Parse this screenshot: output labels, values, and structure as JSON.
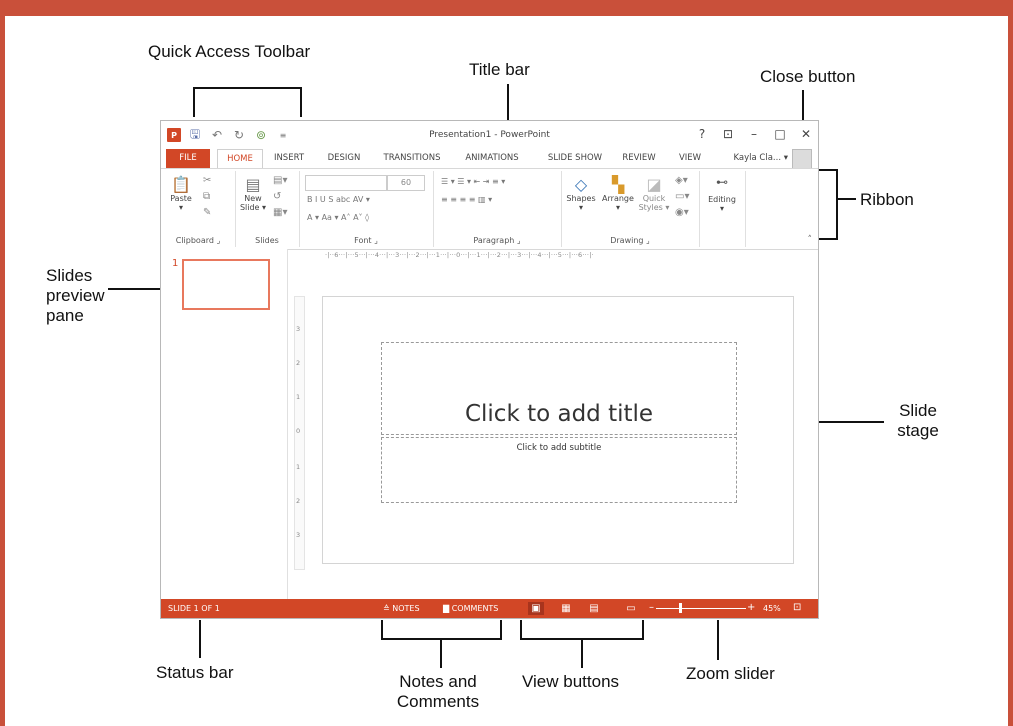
{
  "callouts": {
    "quick_access_toolbar": "Quick Access Toolbar",
    "title_bar": "Title bar",
    "close_button": "Close button",
    "ribbon": "Ribbon",
    "slides_preview_pane_l1": "Slides",
    "slides_preview_pane_l2": "preview",
    "slides_preview_pane_l3": "pane",
    "slide_stage_l1": "Slide",
    "slide_stage_l2": "stage",
    "status_bar": "Status bar",
    "notes_comments_l1": "Notes and",
    "notes_comments_l2": "Comments",
    "view_buttons": "View buttons",
    "zoom_slider": "Zoom slider"
  },
  "window": {
    "title": "Presentation1 - PowerPoint",
    "app_icon": "P",
    "help": "?",
    "ribbon_display": "⊡",
    "minimize": "–",
    "maximize": "□",
    "close": "✕"
  },
  "tabs": [
    "FILE",
    "HOME",
    "INSERT",
    "DESIGN",
    "TRANSITIONS",
    "ANIMATIONS",
    "SLIDE SHOW",
    "REVIEW",
    "VIEW"
  ],
  "user": "Kayla Cla... ▾",
  "ribbon": {
    "paste": "Paste",
    "new_slide_l1": "New",
    "new_slide_l2": "Slide ▾",
    "font_size": "60",
    "shapes": "Shapes",
    "arrange": "Arrange",
    "quick_styles_l1": "Quick",
    "quick_styles_l2": "Styles ▾",
    "editing": "Editing",
    "groups": {
      "clipboard": "Clipboard",
      "slides": "Slides",
      "font": "Font",
      "paragraph": "Paragraph",
      "drawing": "Drawing"
    },
    "font_format": "B  I  U  S  abc  AV ▾",
    "font_size_row": "A ▾  Aa ▾   A˄  A˅   ◊",
    "para_row1": "☰ ▾  ☰ ▾   ⇤  ⇥   ≡ ▾",
    "para_row2": "≡  ≡  ≡  ≡   ▥ ▾"
  },
  "pane": {
    "slide_number": "1"
  },
  "ruler_h": "·|··6···|···5···|···4···|···3···|···2···|···1···|···0···|···1···|···2···|···3···|···4···|···5···|···6···|·",
  "ruler_v": [
    "3",
    "2",
    "1",
    "0",
    "1",
    "2",
    "3"
  ],
  "slide": {
    "title_placeholder": "Click to add title",
    "subtitle_placeholder": "Click to add subtitle"
  },
  "status": {
    "slide_info": "SLIDE 1 OF 1",
    "notes": "≙ NOTES",
    "comments": "▇ COMMENTS",
    "zoom_minus": "–",
    "zoom_plus": "+",
    "zoom_value": "45%",
    "fit": "⊡",
    "view_normal": "▣",
    "view_sorter": "▦",
    "view_reading": "▤",
    "view_slideshow": "▭"
  }
}
